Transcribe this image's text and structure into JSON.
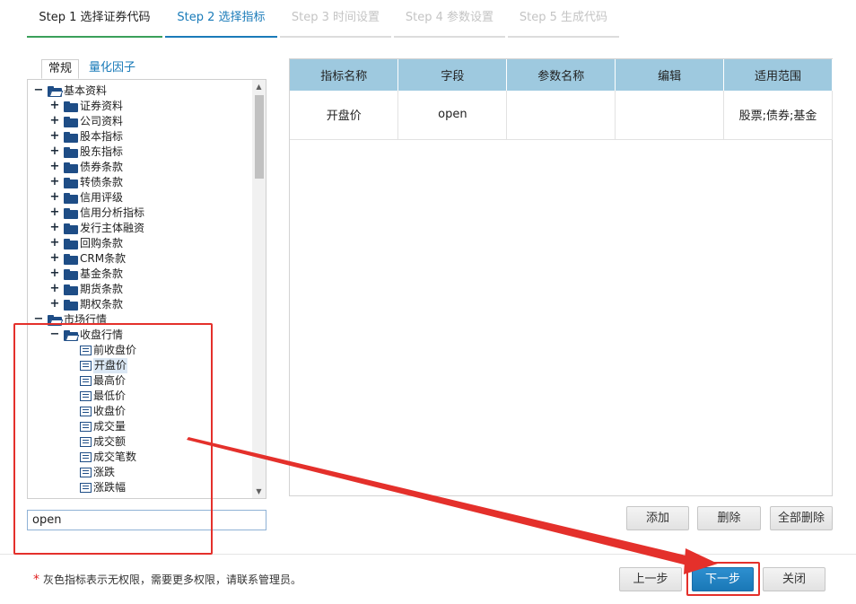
{
  "steps": [
    "Step 1 选择证券代码",
    "Step 2 选择指标",
    "Step 3 时间设置",
    "Step 4 参数设置",
    "Step 5 生成代码"
  ],
  "left_tabs": [
    "常规",
    "量化因子"
  ],
  "tree": {
    "root1": "基本资料",
    "root1_children": [
      "证券资料",
      "公司资料",
      "股本指标",
      "股东指标",
      "债券条款",
      "转债条款",
      "信用评级",
      "信用分析指标",
      "发行主体融资",
      "回购条款",
      "CRM条款",
      "基金条款",
      "期货条款",
      "期权条款"
    ],
    "root2": "市场行情",
    "sub": "收盘行情",
    "leaves": [
      "前收盘价",
      "开盘价",
      "最高价",
      "最低价",
      "收盘价",
      "成交量",
      "成交额",
      "成交笔数",
      "涨跌",
      "涨跌幅"
    ]
  },
  "search": {
    "value": "open"
  },
  "grid": {
    "headers": [
      "指标名称",
      "字段",
      "参数名称",
      "编辑",
      "适用范围"
    ],
    "rows": [
      {
        "name": "开盘价",
        "field": "open",
        "param": "",
        "edit": "",
        "scope": "股票;债券;基金"
      }
    ]
  },
  "buttons": {
    "add": "添加",
    "delete": "删除",
    "delete_all": "全部删除",
    "prev": "上一步",
    "next": "下一步",
    "close": "关闭"
  },
  "note": "灰色指标表示无权限，需要更多权限，请联系管理员。",
  "colors": {
    "annotation": "#e4302b",
    "primary": "#1a78b7",
    "header": "#9ec9df"
  }
}
